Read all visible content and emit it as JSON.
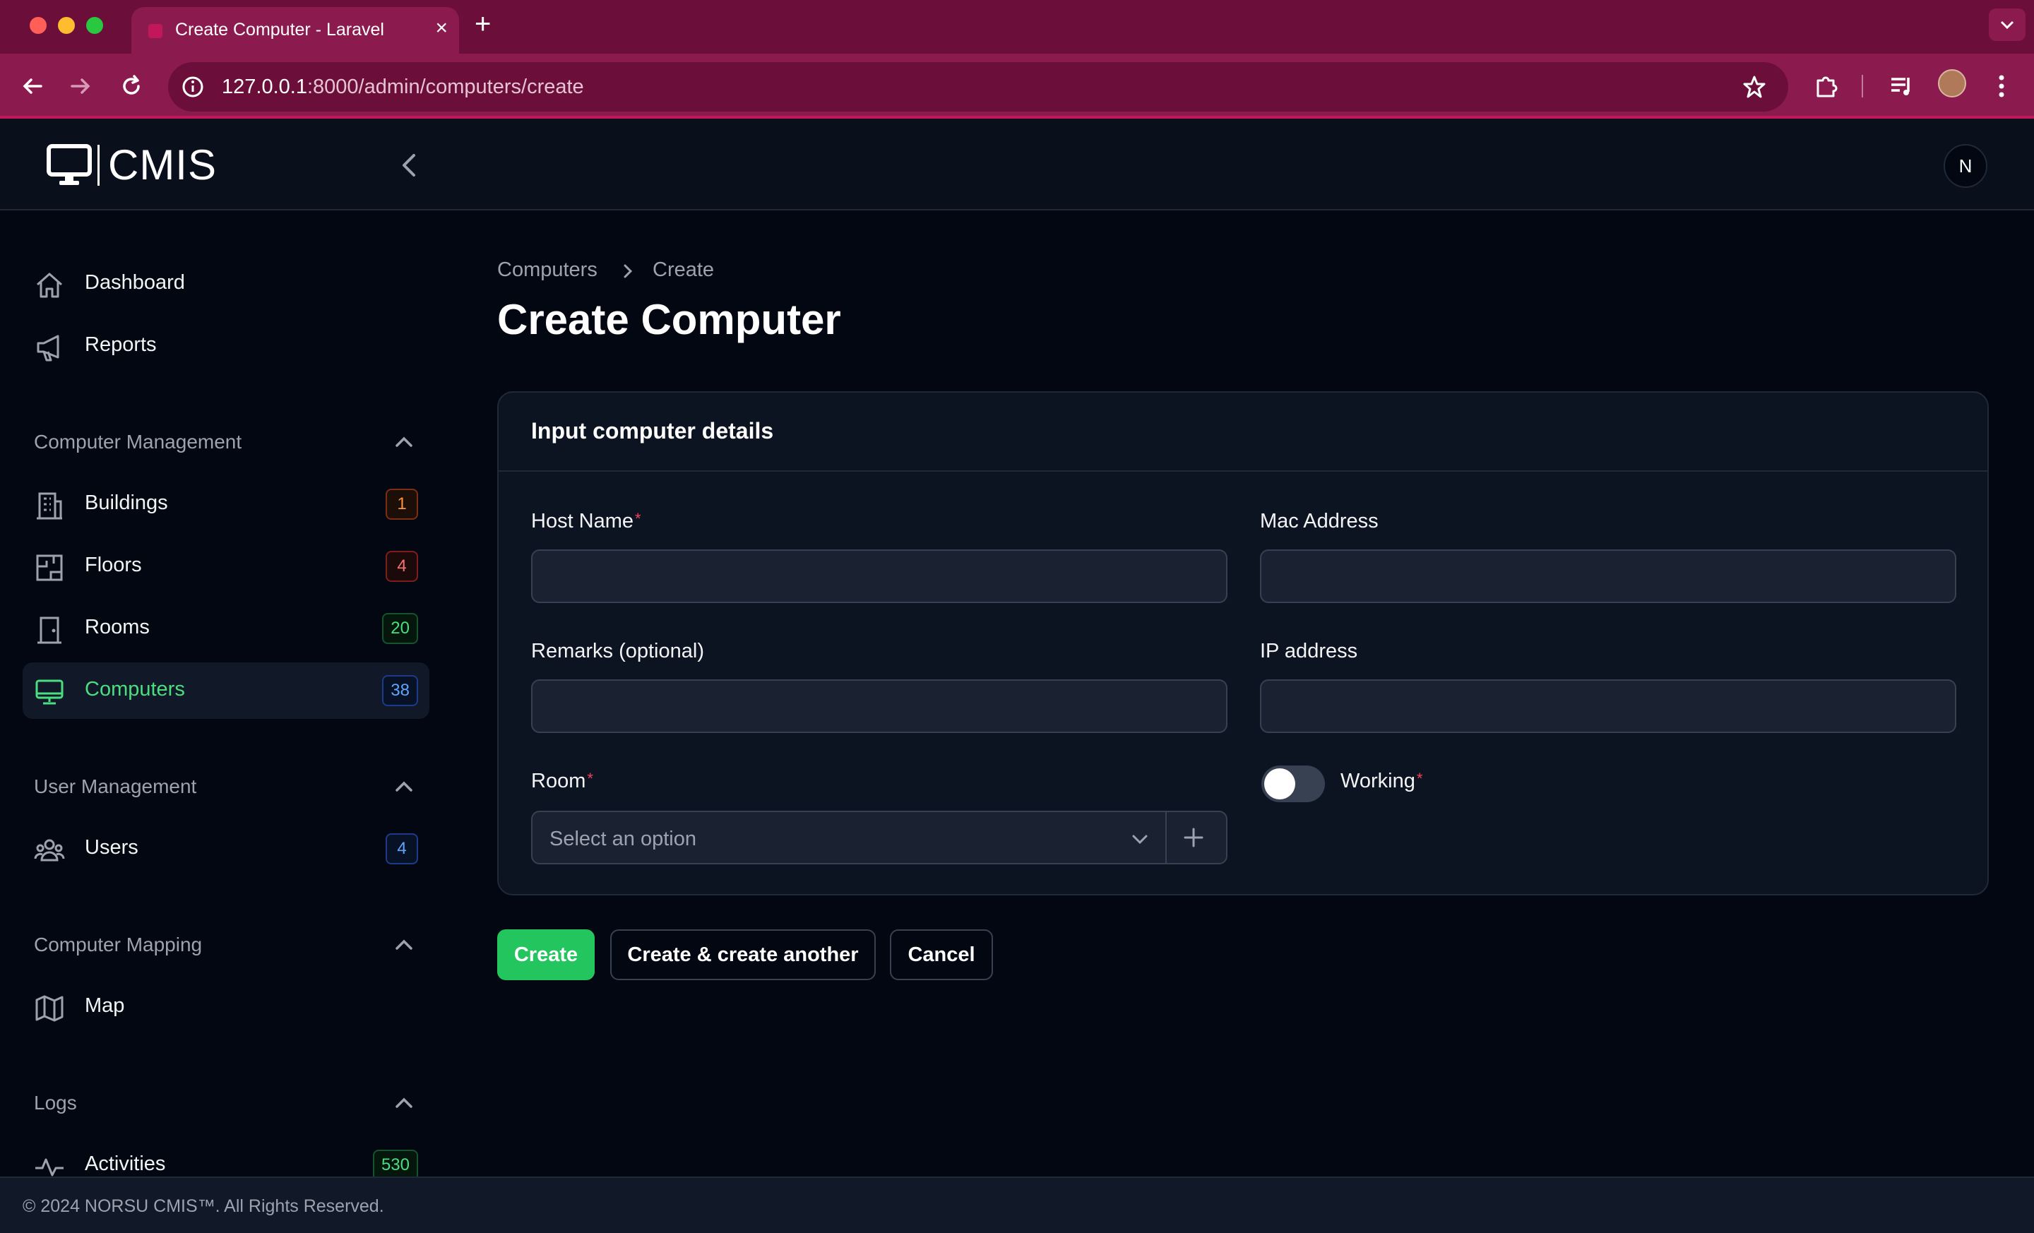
{
  "browser": {
    "tab_title": "Create Computer - Laravel",
    "url_host": "127.0.0.1",
    "url_rest": ":8000/admin/computers/create"
  },
  "app": {
    "logo_text": "CMIS",
    "avatar_initial": "N"
  },
  "sidebar": {
    "top_items": [
      {
        "label": "Dashboard",
        "icon": "home-icon"
      },
      {
        "label": "Reports",
        "icon": "megaphone-icon"
      }
    ],
    "groups": [
      {
        "title": "Computer Management",
        "items": [
          {
            "label": "Buildings",
            "badge": "1",
            "icon": "building-icon",
            "badge_color": "#fb923c"
          },
          {
            "label": "Floors",
            "badge": "4",
            "icon": "floor-plan-icon",
            "badge_color": "#f87171"
          },
          {
            "label": "Rooms",
            "badge": "20",
            "icon": "door-icon",
            "badge_color": "#4ade80"
          },
          {
            "label": "Computers",
            "badge": "38",
            "icon": "monitor-icon",
            "badge_color": "#60a5fa",
            "active": true
          }
        ]
      },
      {
        "title": "User Management",
        "items": [
          {
            "label": "Users",
            "badge": "4",
            "icon": "users-icon",
            "badge_color": "#60a5fa"
          }
        ]
      },
      {
        "title": "Computer Mapping",
        "items": [
          {
            "label": "Map",
            "icon": "map-icon"
          }
        ]
      },
      {
        "title": "Logs",
        "items": [
          {
            "label": "Activities",
            "badge": "530",
            "icon": "activity-icon",
            "badge_color": "#4ade80"
          }
        ]
      }
    ]
  },
  "breadcrumb": {
    "parent": "Computers",
    "current": "Create"
  },
  "page_title": "Create Computer",
  "form": {
    "section_title": "Input computer details",
    "host_name": {
      "label": "Host Name",
      "required_mark": "*",
      "value": ""
    },
    "mac_address": {
      "label": "Mac Address",
      "value": ""
    },
    "remarks": {
      "label": "Remarks (optional)",
      "value": ""
    },
    "ip_address": {
      "label": "IP address",
      "value": ""
    },
    "room": {
      "label": "Room",
      "required_mark": "*",
      "placeholder": "Select an option"
    },
    "working": {
      "label": "Working",
      "required_mark": "*",
      "checked": false
    }
  },
  "actions": {
    "create": "Create",
    "create_another": "Create & create another",
    "cancel": "Cancel"
  },
  "footer": {
    "text": "© 2024 NORSU CMIS™. All Rights Reserved."
  },
  "colors": {
    "accent": "#22c55e",
    "browser_frame": "#6b0f3a",
    "background": "#030712"
  }
}
